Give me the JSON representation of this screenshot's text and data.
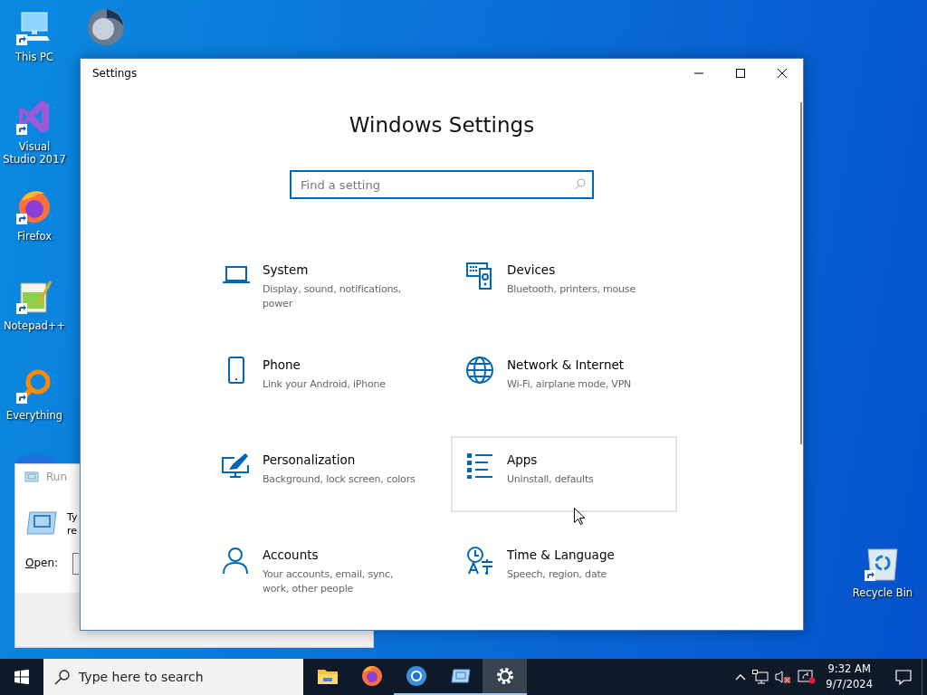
{
  "desktop_icons": [
    {
      "label": "This PC",
      "kind": "pc"
    },
    {
      "label": "Visual Studio 2017",
      "kind": "vs"
    },
    {
      "label": "Firefox",
      "kind": "firefox"
    },
    {
      "label": "Notepad++",
      "kind": "notepad"
    },
    {
      "label": "Everything",
      "kind": "everything"
    }
  ],
  "recycle_bin": {
    "label": "Recycle Bin"
  },
  "run_dialog": {
    "title": "Run",
    "text_lines": [
      "Ty",
      "re"
    ],
    "open_label": "Open:"
  },
  "settings_window": {
    "title": "Settings",
    "heading": "Windows Settings",
    "search": {
      "placeholder": "Find a setting",
      "focused": true
    },
    "tiles": [
      {
        "kind": "system",
        "title": "System",
        "description": "Display, sound, notifications, power",
        "hovered": false
      },
      {
        "kind": "devices",
        "title": "Devices",
        "description": "Bluetooth, printers, mouse",
        "hovered": false
      },
      {
        "kind": "phone",
        "title": "Phone",
        "description": "Link your Android, iPhone",
        "hovered": false
      },
      {
        "kind": "network",
        "title": "Network & Internet",
        "description": "Wi-Fi, airplane mode, VPN",
        "hovered": false
      },
      {
        "kind": "personalization",
        "title": "Personalization",
        "description": "Background, lock screen, colors",
        "hovered": false
      },
      {
        "kind": "apps",
        "title": "Apps",
        "description": "Uninstall, defaults",
        "hovered": true
      },
      {
        "kind": "accounts",
        "title": "Accounts",
        "description": "Your accounts, email, sync, work, other people",
        "hovered": false
      },
      {
        "kind": "time",
        "title": "Time & Language",
        "description": "Speech, region, date",
        "hovered": false
      }
    ]
  },
  "taskbar": {
    "search": {
      "placeholder": "Type here to search"
    },
    "apps": [
      {
        "kind": "folder",
        "running": false,
        "active": false
      },
      {
        "kind": "firefox",
        "running": false,
        "active": false
      },
      {
        "kind": "chrome",
        "running": true,
        "active": false
      },
      {
        "kind": "run",
        "running": true,
        "active": false
      },
      {
        "kind": "settings",
        "running": true,
        "active": true
      }
    ],
    "time": "9:32 AM",
    "date": "9/7/2024"
  }
}
